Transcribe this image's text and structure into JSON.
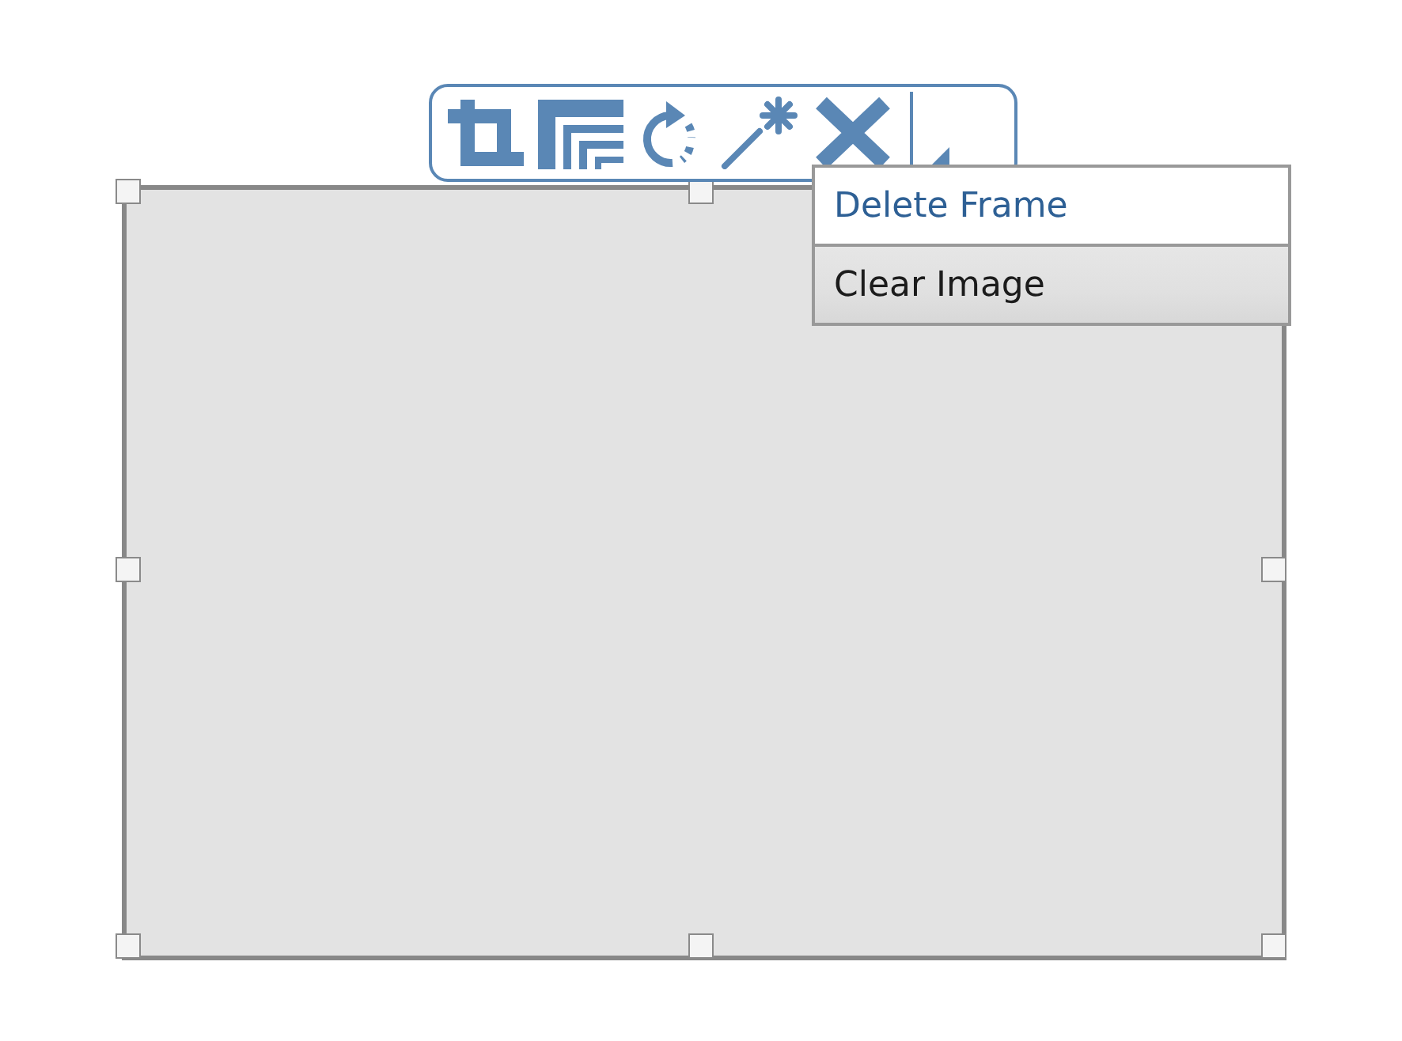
{
  "context_menu": {
    "items": [
      {
        "label": "Delete Frame",
        "selected": true
      },
      {
        "label": "Clear Image",
        "selected": false
      }
    ]
  }
}
